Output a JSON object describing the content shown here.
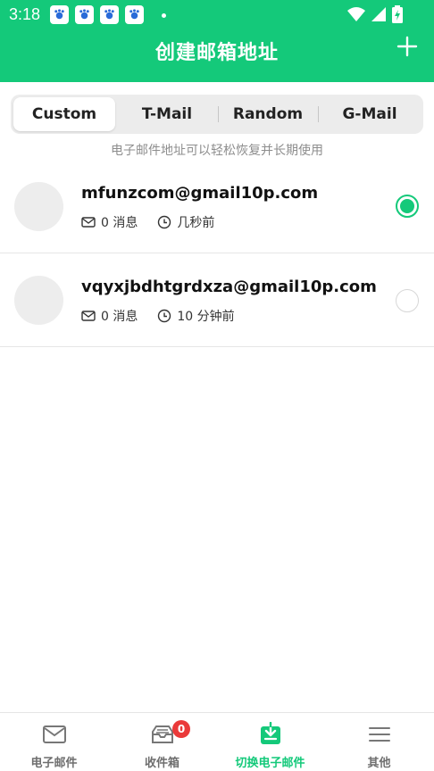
{
  "status_bar": {
    "time": "3:18"
  },
  "header": {
    "title": "创建邮箱地址"
  },
  "segment": {
    "tabs": [
      "Custom",
      "T-Mail",
      "Random",
      "G-Mail"
    ],
    "active": 0
  },
  "hint": "电子邮件地址可以轻松恢复并长期使用",
  "addresses": [
    {
      "email": "mfunzcom@gmail10p.com",
      "messages": "0 消息",
      "time": "几秒前",
      "selected": true
    },
    {
      "email": "vqyxjbdhtgrdxza@gmail10p.com",
      "messages": "0 消息",
      "time": "10 分钟前",
      "selected": false
    }
  ],
  "bottom_nav": {
    "items": [
      {
        "label": "电子邮件"
      },
      {
        "label": "收件箱",
        "badge": "0"
      },
      {
        "label": "切换电子邮件"
      },
      {
        "label": "其他"
      }
    ],
    "active": 2
  },
  "colors": {
    "accent": "#14c97a",
    "badge": "#ea3a3a"
  }
}
